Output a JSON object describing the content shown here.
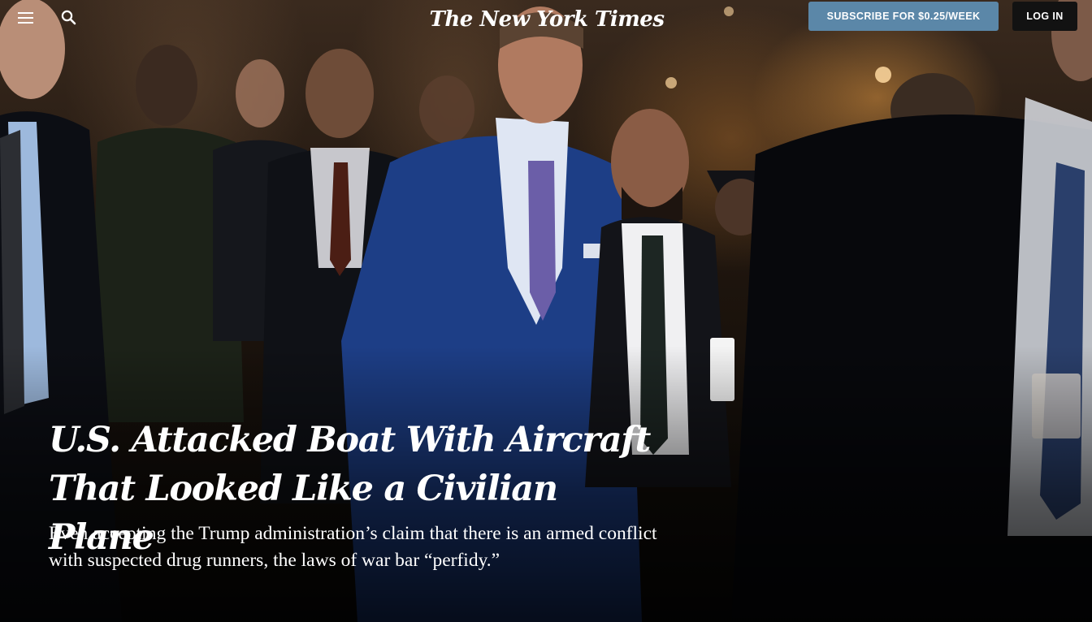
{
  "header": {
    "logo_text": "The New York Times",
    "subscribe_label": "SUBSCRIBE FOR $0.25/WEEK",
    "login_label": "LOG IN",
    "menu_icon": "hamburger-menu-icon",
    "search_icon": "search-icon"
  },
  "article": {
    "headline": "U.S. Attacked Boat With Aircraft That Looked Like a Civilian Plane",
    "summary": "Even accepting the Trump administration’s claim that there is an armed conflict with suspected drug runners, the laws of war bar “perfidy.”"
  },
  "colors": {
    "subscribe_bg": "#5b87a8",
    "login_bg": "#121212",
    "text": "#ffffff"
  }
}
